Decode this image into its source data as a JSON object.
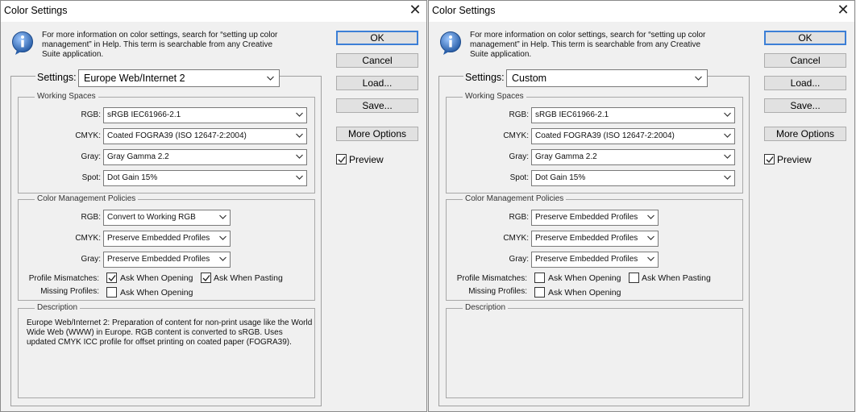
{
  "dialogs": [
    {
      "title": "Color Settings",
      "info_text": "For more information on color settings, search for “setting up color management” in Help. This term is searchable from any Creative Suite application.",
      "buttons": {
        "ok": "OK",
        "cancel": "Cancel",
        "load": "Load...",
        "save": "Save...",
        "more_options": "More Options"
      },
      "preview": {
        "label": "Preview",
        "checked": true
      },
      "settings": {
        "label": "Settings:",
        "value": "Europe Web/Internet 2"
      },
      "working_spaces": {
        "title": "Working Spaces",
        "rgb": {
          "label": "RGB:",
          "value": "sRGB IEC61966-2.1"
        },
        "cmyk": {
          "label": "CMYK:",
          "value": "Coated FOGRA39 (ISO 12647-2:2004)"
        },
        "gray": {
          "label": "Gray:",
          "value": "Gray Gamma 2.2"
        },
        "spot": {
          "label": "Spot:",
          "value": "Dot Gain 15%"
        }
      },
      "policies": {
        "title": "Color Management Policies",
        "rgb": {
          "label": "RGB:",
          "value": "Convert to Working RGB"
        },
        "cmyk": {
          "label": "CMYK:",
          "value": "Preserve Embedded Profiles"
        },
        "gray": {
          "label": "Gray:",
          "value": "Preserve Embedded Profiles"
        },
        "profile_mismatches_label": "Profile Mismatches:",
        "mismatch_opening": {
          "label": "Ask When Opening",
          "checked": true
        },
        "mismatch_pasting": {
          "label": "Ask When Pasting",
          "checked": true
        },
        "missing_profiles_label": "Missing Profiles:",
        "missing_opening": {
          "label": "Ask When Opening",
          "checked": false
        }
      },
      "description": {
        "title": "Description",
        "text": "Europe Web/Internet 2:  Preparation of content for non-print usage like the World Wide Web (WWW) in Europe. RGB content is converted to sRGB. Uses updated CMYK ICC profile for offset printing on coated paper (FOGRA39)."
      }
    },
    {
      "title": "Color Settings",
      "info_text": "For more information on color settings, search for “setting up color management” in Help. This term is searchable from any Creative Suite application.",
      "buttons": {
        "ok": "OK",
        "cancel": "Cancel",
        "load": "Load...",
        "save": "Save...",
        "more_options": "More Options"
      },
      "preview": {
        "label": "Preview",
        "checked": true
      },
      "settings": {
        "label": "Settings:",
        "value": "Custom"
      },
      "working_spaces": {
        "title": "Working Spaces",
        "rgb": {
          "label": "RGB:",
          "value": "sRGB IEC61966-2.1"
        },
        "cmyk": {
          "label": "CMYK:",
          "value": "Coated FOGRA39 (ISO 12647-2:2004)"
        },
        "gray": {
          "label": "Gray:",
          "value": "Gray Gamma 2.2"
        },
        "spot": {
          "label": "Spot:",
          "value": "Dot Gain 15%"
        }
      },
      "policies": {
        "title": "Color Management Policies",
        "rgb": {
          "label": "RGB:",
          "value": "Preserve Embedded Profiles"
        },
        "cmyk": {
          "label": "CMYK:",
          "value": "Preserve Embedded Profiles"
        },
        "gray": {
          "label": "Gray:",
          "value": "Preserve Embedded Profiles"
        },
        "profile_mismatches_label": "Profile Mismatches:",
        "mismatch_opening": {
          "label": "Ask When Opening",
          "checked": false
        },
        "mismatch_pasting": {
          "label": "Ask When Pasting",
          "checked": false
        },
        "missing_profiles_label": "Missing Profiles:",
        "missing_opening": {
          "label": "Ask When Opening",
          "checked": false
        }
      },
      "description": {
        "title": "Description",
        "text": ""
      }
    }
  ],
  "icons": {
    "close": "close-icon",
    "info": "info-icon",
    "dropdown": "chevron-down-icon",
    "check": "checkmark-icon"
  },
  "colors": {
    "default_button_border": "#3c7fd6",
    "info_icon_blue": "#2a5fa8"
  }
}
